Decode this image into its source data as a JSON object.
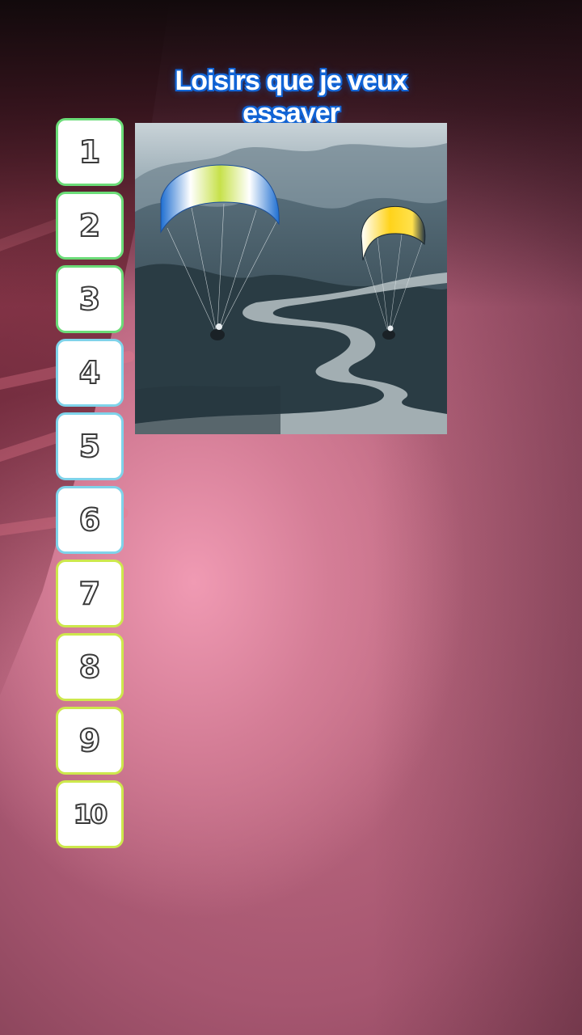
{
  "title": "Loisirs que je veux essayer",
  "ranks": [
    {
      "label": "1",
      "color": "green"
    },
    {
      "label": "2",
      "color": "green"
    },
    {
      "label": "3",
      "color": "green"
    },
    {
      "label": "4",
      "color": "blue"
    },
    {
      "label": "5",
      "color": "blue"
    },
    {
      "label": "6",
      "color": "blue"
    },
    {
      "label": "7",
      "color": "yellow"
    },
    {
      "label": "8",
      "color": "yellow"
    },
    {
      "label": "9",
      "color": "yellow"
    },
    {
      "label": "10",
      "color": "yellow"
    }
  ],
  "current_item": {
    "caption": "paragliding",
    "image": "paragliders-over-river-valley"
  },
  "colors": {
    "title_outline": "#1466d6",
    "green_border": "#6bdc78",
    "blue_border": "#7fd3ea",
    "yellow_border": "#cde84c"
  }
}
